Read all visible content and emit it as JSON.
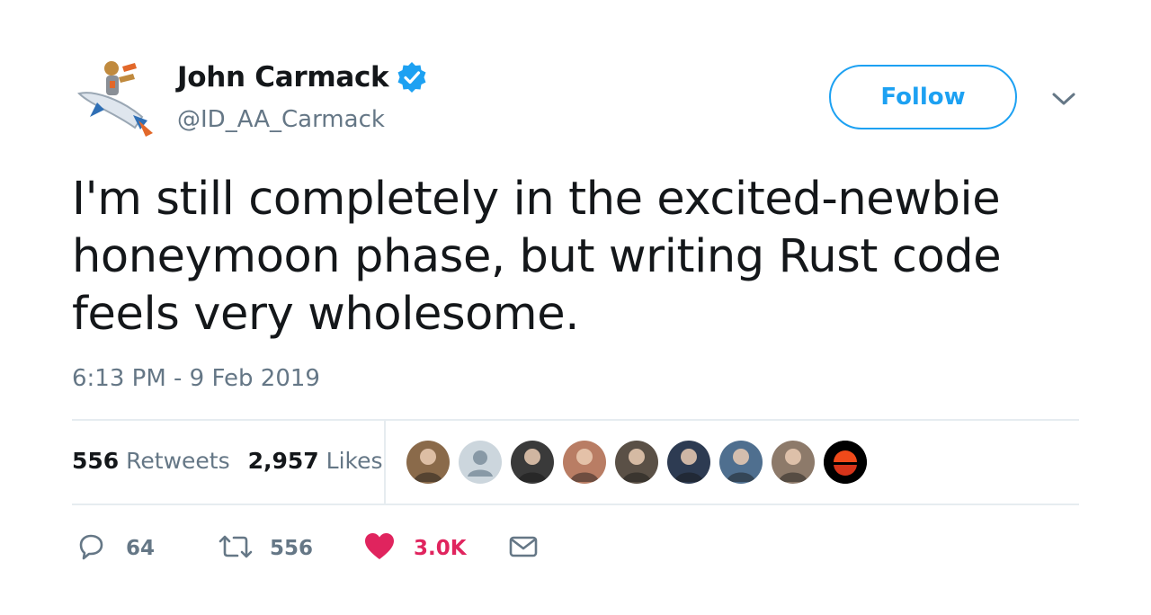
{
  "author": {
    "name": "John Carmack",
    "handle": "@ID_AA_Carmack",
    "verified": true
  },
  "follow_label": "Follow",
  "tweet_text": "I'm still completely in the excited-newbie honeymoon phase, but writing Rust code feels very wholesome.",
  "timestamp": "6:13 PM - 9 Feb 2019",
  "stats": {
    "retweets_count": "556",
    "retweets_label": "Retweets",
    "likes_count": "2,957",
    "likes_label": "Likes"
  },
  "liker_avatars": [
    {
      "kind": "photo",
      "bg": "#8a6a4a"
    },
    {
      "kind": "default",
      "bg": "#ccd6dd"
    },
    {
      "kind": "photo",
      "bg": "#3a3a3a"
    },
    {
      "kind": "photo",
      "bg": "#b97d64"
    },
    {
      "kind": "photo",
      "bg": "#5a5046"
    },
    {
      "kind": "photo",
      "bg": "#2d3b52"
    },
    {
      "kind": "photo",
      "bg": "#4f6f8f"
    },
    {
      "kind": "photo",
      "bg": "#8d7a6a"
    },
    {
      "kind": "sunset",
      "bg": "#000000"
    }
  ],
  "actions": {
    "reply_count": "64",
    "retweet_count": "556",
    "like_count": "3.0K"
  },
  "colors": {
    "accent": "#1da1f2",
    "text": "#14171a",
    "secondary": "#657786",
    "like": "#e0245e",
    "divider": "#e6ecf0"
  }
}
